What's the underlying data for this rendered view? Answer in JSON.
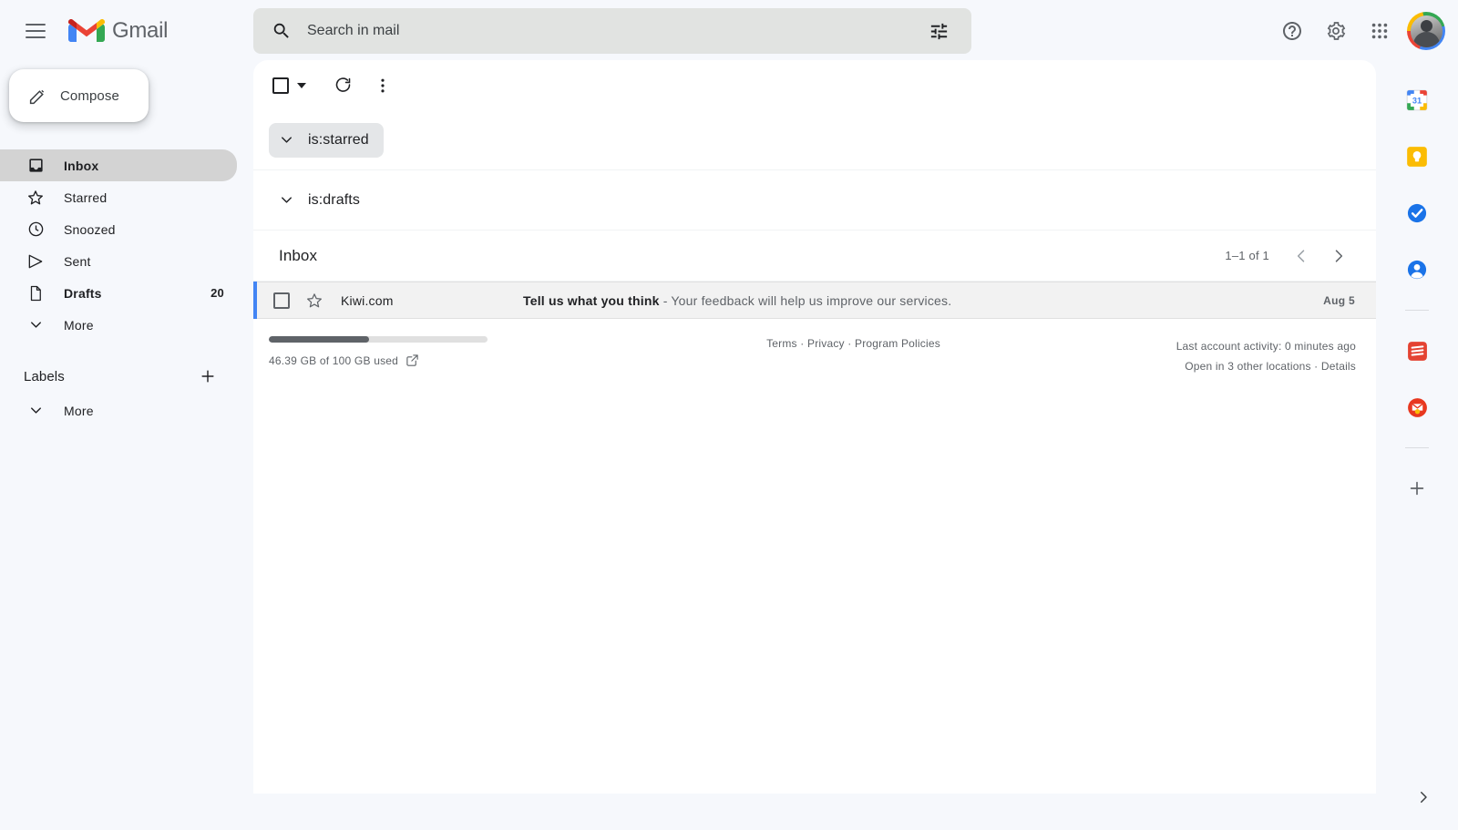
{
  "app": {
    "name": "Gmail"
  },
  "topbar": {
    "menu_icon": "hamburger-menu-icon",
    "logo_icon": "gmail-logo-icon",
    "help_icon": "help-icon",
    "settings_icon": "gear-icon",
    "apps_icon": "google-apps-grid-icon",
    "avatar_icon": "account-avatar"
  },
  "search": {
    "placeholder": "Search in mail",
    "value": "",
    "search_icon": "search-icon",
    "filter_icon": "tune-filter-icon"
  },
  "sidebar": {
    "compose": {
      "label": "Compose",
      "icon": "pencil-compose-icon"
    },
    "items": [
      {
        "label": "Inbox",
        "icon": "inbox-icon",
        "count": "",
        "active": true,
        "bold": true
      },
      {
        "label": "Starred",
        "icon": "star-icon",
        "count": "",
        "active": false,
        "bold": false
      },
      {
        "label": "Snoozed",
        "icon": "clock-icon",
        "count": "",
        "active": false,
        "bold": false
      },
      {
        "label": "Sent",
        "icon": "send-icon",
        "count": "",
        "active": false,
        "bold": false
      },
      {
        "label": "Drafts",
        "icon": "document-icon",
        "count": "20",
        "active": false,
        "bold": true
      },
      {
        "label": "More",
        "icon": "chevron-down-icon",
        "count": "",
        "active": false,
        "bold": false
      }
    ],
    "labels": {
      "title": "Labels",
      "add_icon": "plus-icon",
      "more_label": "More",
      "more_icon": "chevron-down-icon"
    }
  },
  "toolbar": {
    "select_all_icon": "checkbox-icon",
    "select_all_caret": "caret-down-icon",
    "refresh_icon": "refresh-icon",
    "more_icon": "more-vertical-icon"
  },
  "sections": [
    {
      "label": "is:starred",
      "icon": "chevron-down-icon",
      "selected": true
    },
    {
      "label": "is:drafts",
      "icon": "chevron-down-icon",
      "selected": false
    }
  ],
  "inbox": {
    "title": "Inbox",
    "pagination": {
      "count": "1–1 of 1",
      "prev_icon": "chevron-left-icon",
      "next_icon": "chevron-right-icon"
    },
    "emails": [
      {
        "sender": "Kiwi.com",
        "subject": "Tell us what you think",
        "separator": " - ",
        "snippet": "Your feedback will help us improve our services.",
        "date": "Aug 5",
        "checkbox_icon": "checkbox-icon",
        "star_icon": "star-icon",
        "unread": true,
        "selected": true
      }
    ]
  },
  "footer": {
    "storage_used_pct": 46,
    "storage_text": "46.39 GB of 100 GB used",
    "storage_link_icon": "external-link-icon",
    "links": "Terms · Privacy · Program Policies",
    "activity": "Last account activity: 0 minutes ago",
    "locations": "Open in 3 other locations · Details"
  },
  "rail": {
    "apps": [
      {
        "name": "google-calendar-icon",
        "title": "Calendar",
        "day": "31"
      },
      {
        "name": "google-keep-icon",
        "title": "Keep"
      },
      {
        "name": "google-tasks-icon",
        "title": "Tasks"
      },
      {
        "name": "google-contacts-icon",
        "title": "Contacts"
      },
      {
        "name": "todoist-icon",
        "title": "Todoist"
      },
      {
        "name": "mailtrack-icon",
        "title": "Mail add-on"
      }
    ],
    "add_icon": "plus-icon",
    "expand_icon": "chevron-right-icon"
  },
  "colors": {
    "accent_blue": "#4285f4",
    "red": "#ea4335",
    "yellow": "#fbbc04",
    "green": "#34a853",
    "page_bg": "#f6f8fc",
    "panel_bg": "#ffffff"
  }
}
